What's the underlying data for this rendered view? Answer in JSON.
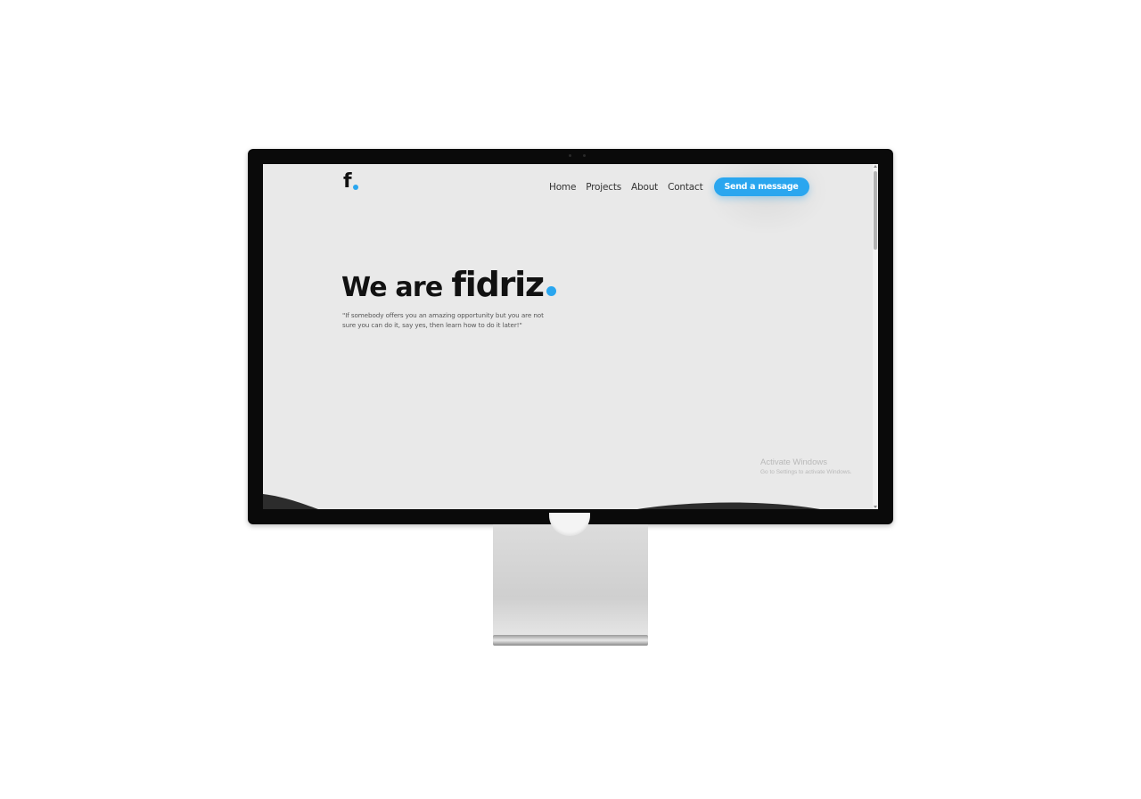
{
  "brand": {
    "logo_letter": "f",
    "accent_color": "#2aa6ef"
  },
  "nav": {
    "items": [
      "Home",
      "Projects",
      "About",
      "Contact"
    ],
    "cta_label": "Send a message"
  },
  "hero": {
    "headline_prefix": "We are",
    "headline_brand": "fidriz",
    "quote": "\"If somebody offers you an amazing opportunity but you are not sure you can do it, say yes, then learn how to do it later!\""
  },
  "windows_watermark": {
    "title": "Activate Windows",
    "subtitle": "Go to Settings to activate Windows."
  }
}
